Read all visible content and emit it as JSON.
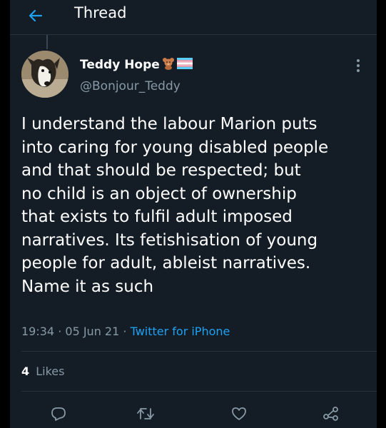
{
  "header": {
    "title": "Thread",
    "back_icon": "arrow-left-icon",
    "accent": "#1da1f2"
  },
  "tweet": {
    "author": {
      "name": "Teddy Hope",
      "name_emojis": [
        "teddy-bear-emoji",
        "transgender-flag-emoji"
      ],
      "handle": "@Bonjour_Teddy",
      "avatar": "dog-avatar"
    },
    "text_lines": [
      "I understand the labour Marion puts",
      "into caring for young disabled people",
      "and that should be respected; but",
      "no child is an object of ownership",
      "that exists to fulfil adult imposed",
      "narratives.  Its fetishisation of young",
      "people for adult, ableist narratives.",
      "Name it as such"
    ],
    "time": "19:34",
    "date": "05 Jun 21",
    "separator": "·",
    "source": "Twitter for iPhone",
    "likes_count": "4",
    "likes_label": "Likes"
  },
  "actions": [
    "reply-icon",
    "retweet-icon",
    "like-icon",
    "share-icon"
  ],
  "colors": {
    "background": "#141d26",
    "secondary_text": "#8899a6",
    "link": "#1da1f2",
    "divider": "#26323d"
  }
}
